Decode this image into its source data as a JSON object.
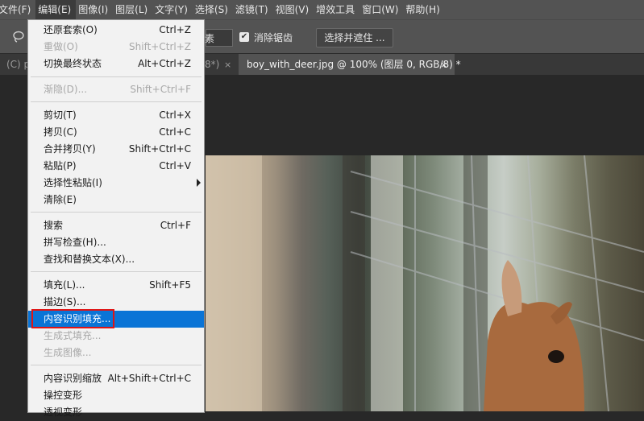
{
  "menubar": {
    "items": [
      "文件(F)",
      "编辑(E)",
      "图像(I)",
      "图层(L)",
      "文字(Y)",
      "选择(S)",
      "滤镜(T)",
      "视图(V)",
      "增效工具",
      "窗口(W)",
      "帮助(H)"
    ]
  },
  "options_bar": {
    "feather_tail": "素",
    "anti_alias_label": "消除锯齿",
    "select_mask_label": "选择并遮住 ..."
  },
  "tabs": {
    "tab1": {
      "label": "(C) p",
      "tail": "8*)",
      "close": "×"
    },
    "tab2": {
      "label": "boy_with_deer.jpg @ 100% (图层 0, RGB/8) *",
      "close": "×"
    }
  },
  "edit_menu": {
    "items": [
      {
        "label": "还原套索(O)",
        "shortcut": "Ctrl+Z"
      },
      {
        "label": "重做(O)",
        "shortcut": "Shift+Ctrl+Z",
        "disabled": true
      },
      {
        "label": "切换最终状态",
        "shortcut": "Alt+Ctrl+Z"
      },
      {
        "label": "渐隐(D)...",
        "shortcut": "Shift+Ctrl+F",
        "disabled": true
      },
      {
        "label": "剪切(T)",
        "shortcut": "Ctrl+X"
      },
      {
        "label": "拷贝(C)",
        "shortcut": "Ctrl+C"
      },
      {
        "label": "合并拷贝(Y)",
        "shortcut": "Shift+Ctrl+C"
      },
      {
        "label": "粘贴(P)",
        "shortcut": "Ctrl+V"
      },
      {
        "label": "选择性粘贴(I)",
        "shortcut": ""
      },
      {
        "label": "清除(E)",
        "shortcut": ""
      },
      {
        "label": "搜索",
        "shortcut": "Ctrl+F"
      },
      {
        "label": "拼写检查(H)...",
        "shortcut": ""
      },
      {
        "label": "查找和替换文本(X)...",
        "shortcut": ""
      },
      {
        "label": "填充(L)...",
        "shortcut": "Shift+F5"
      },
      {
        "label": "描边(S)...",
        "shortcut": ""
      },
      {
        "label": "内容识别填充...",
        "shortcut": "",
        "highlighted": true
      },
      {
        "label": "生成式填充...",
        "shortcut": "",
        "disabled": true
      },
      {
        "label": "生成图像...",
        "shortcut": "",
        "disabled": true
      },
      {
        "label": "内容识别缩放",
        "shortcut": "Alt+Shift+Ctrl+C"
      },
      {
        "label": "操控变形",
        "shortcut": ""
      },
      {
        "label": "透视变形",
        "shortcut": ""
      }
    ]
  },
  "colors": {
    "highlight": "#0a74d6",
    "annotation_box": "#e01515",
    "menubar": "#535353"
  }
}
